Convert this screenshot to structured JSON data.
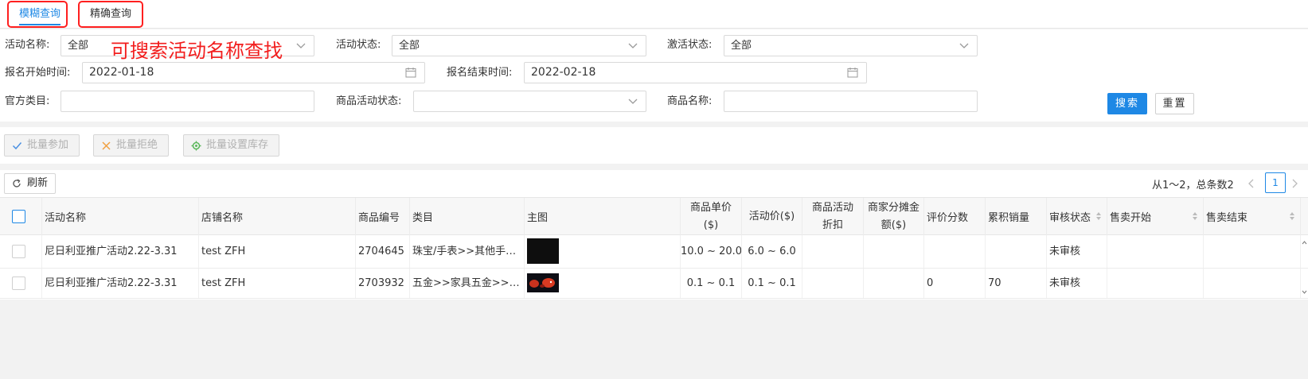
{
  "tabs": [
    {
      "label": "模糊查询",
      "active": true
    },
    {
      "label": "精确查询",
      "active": false
    }
  ],
  "annotation": "可搜索活动名称查找",
  "filters": {
    "activity_name": {
      "label": "活动名称:",
      "value": "全部"
    },
    "activity_status": {
      "label": "活动状态:",
      "value": "全部"
    },
    "activation_status": {
      "label": "激活状态:",
      "value": "全部"
    },
    "signup_start": {
      "label": "报名开始时间:",
      "value": "2022-01-18"
    },
    "signup_end": {
      "label": "报名结束时间:",
      "value": "2022-02-18"
    },
    "official_category": {
      "label": "官方类目:",
      "value": ""
    },
    "product_activity_status": {
      "label": "商品活动状态:",
      "value": ""
    },
    "product_name": {
      "label": "商品名称:",
      "value": ""
    }
  },
  "buttons": {
    "search": "搜索",
    "reset": "重置",
    "batch_join": "批量参加",
    "batch_reject": "批量拒绝",
    "batch_stock": "批量设置库存",
    "refresh": "刷新"
  },
  "pagination": {
    "info": "从1～2，总条数2",
    "current": "1"
  },
  "table": {
    "columns": [
      "活动名称",
      "店铺名称",
      "商品编号",
      "类目",
      "主图",
      "商品单价($)",
      "活动价($)",
      "商品活动折扣",
      "商家分摊金额($)",
      "评价分数",
      "累积销量",
      "审核状态",
      "售卖开始",
      "售卖结束"
    ],
    "rows": [
      {
        "activity": "尼日利亚推广活动2.22-3.31",
        "shop": "test ZFH",
        "product_no": "2704645",
        "category": "珠宝/手表>>其他手…",
        "unit_price": "10.0 ~ 20.0",
        "activity_price": "6.0 ~ 6.0",
        "discount": "",
        "merchant_share": "",
        "rating": "",
        "sales": "",
        "review_status": "未审核",
        "sale_start": "",
        "sale_end": ""
      },
      {
        "activity": "尼日利亚推广活动2.22-3.31",
        "shop": "test ZFH",
        "product_no": "2703932",
        "category": "五金>>家具五金>>…",
        "unit_price": "0.1 ~ 0.1",
        "activity_price": "0.1 ~ 0.1",
        "discount": "",
        "merchant_share": "",
        "rating": "0",
        "sales": "70",
        "review_status": "未审核",
        "sale_start": "",
        "sale_end": ""
      }
    ]
  },
  "colors": {
    "accent": "#1e88e5",
    "highlight": "#ff1f1f",
    "annotation": "#f21d1d"
  }
}
